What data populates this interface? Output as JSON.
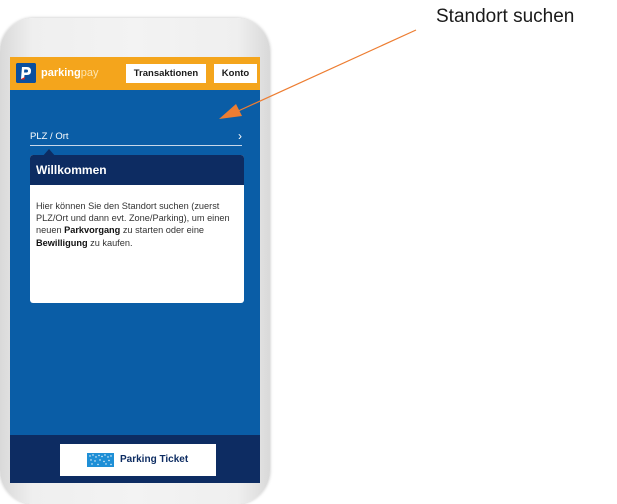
{
  "app": {
    "brand_bold": "parking",
    "brand_light": "pay"
  },
  "header": {
    "transactions_label": "Transaktionen",
    "account_label": "Konto"
  },
  "search": {
    "label": "PLZ / Ort",
    "chevron": "›"
  },
  "welcome": {
    "title": "Willkommen",
    "text_1": "Hier können Sie den Standort suchen (zuerst PLZ/Ort und dann evt. Zone/Parking), um einen neuen ",
    "bold_1": "Parkvorgang",
    "text_2": " zu starten oder eine ",
    "bold_2": "Bewilligung",
    "text_3": " zu kaufen."
  },
  "footer": {
    "ticket_label": "Parking Ticket",
    "ticket_icon": "parking-ticket-icon"
  },
  "annotation": {
    "label": "Standort suchen"
  },
  "colors": {
    "header_bg": "#f4a51c",
    "screen_bg": "#0a5da6",
    "dark_navy": "#0d2c62",
    "annotation_arrow": "#ed7d31"
  }
}
